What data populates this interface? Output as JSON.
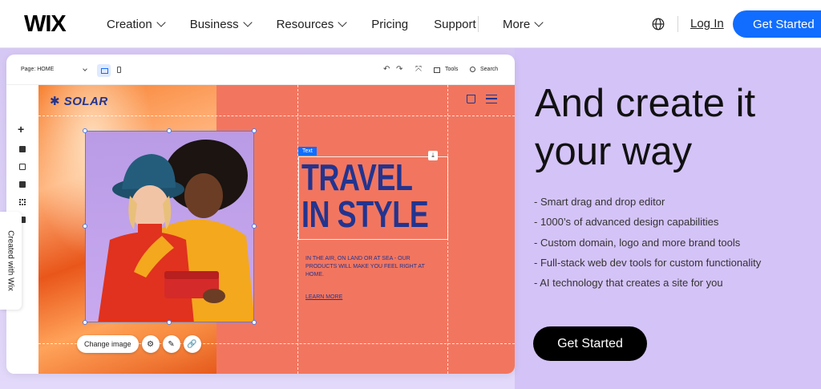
{
  "nav": {
    "logo": "WIX",
    "menu": [
      "Creation",
      "Business",
      "Resources",
      "Pricing",
      "Support"
    ],
    "more": "More",
    "login": "Log In",
    "cta": "Get Started"
  },
  "editor": {
    "toolbar": {
      "page_label": "Page: HOME",
      "tools": "Tools",
      "search": "Search"
    },
    "site": {
      "logo": "✱ SOLAR",
      "text_tag": "Text",
      "headline_line1": "TRAVEL",
      "headline_line2": "IN STYLE",
      "subtext": "IN THE AIR, ON LAND OR AT SEA - OUR PRODUCTS WILL MAKE YOU FEEL RIGHT AT HOME.",
      "learn_more": "LEARN MORE"
    },
    "image_toolbar": {
      "change_image": "Change image"
    },
    "created_with": "Created with Wix"
  },
  "hero": {
    "title": "And create it your way",
    "features": [
      "Smart drag and drop editor",
      "1000’s of advanced design capabilities",
      "Custom domain, logo and more brand tools",
      "Full-stack web dev tools for custom functionality",
      "AI technology that creates a site for you"
    ],
    "cta": "Get Started"
  },
  "colors": {
    "brand_blue": "#116dff",
    "hero_bg": "#d4c3f7",
    "site_coral": "#f2765f",
    "site_navy": "#23348f"
  }
}
